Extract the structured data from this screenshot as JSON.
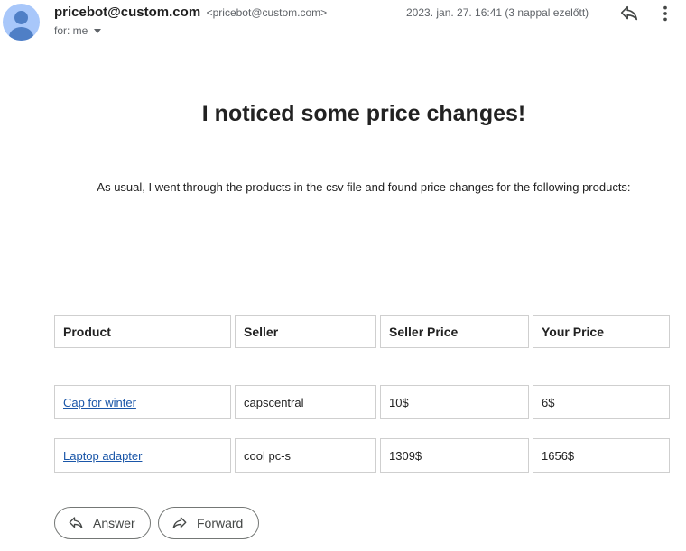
{
  "sender": {
    "name": "pricebot@custom.com",
    "email": "<pricebot@custom.com>",
    "to_label": "for: me",
    "date": "2023. jan. 27. 16:41 (3 nappal ezelőtt)"
  },
  "email_body": {
    "heading": "I noticed some price changes!",
    "intro": "As usual, I went through the products in the csv file and found price changes for the following products:"
  },
  "table": {
    "headers": [
      "Product",
      "Seller",
      "Seller Price",
      "Your Price"
    ],
    "rows": [
      {
        "product": "Cap for winter",
        "seller": "capscentral",
        "seller_price": "10$",
        "your_price": "6$"
      },
      {
        "product": "Laptop adapter",
        "seller": "cool pc-s",
        "seller_price": "1309$",
        "your_price": "1656$"
      }
    ]
  },
  "actions": {
    "answer": "Answer",
    "forward": "Forward"
  },
  "icons": {
    "avatar": "default-avatar-icon",
    "reply": "reply-icon",
    "more": "more-vert-icon",
    "answer": "reply-arrow-icon",
    "forward": "forward-arrow-icon"
  },
  "colors": {
    "link": "#1a56a8",
    "avatar_bg": "#a8c7fa",
    "avatar_fg": "#4f7fc6"
  }
}
